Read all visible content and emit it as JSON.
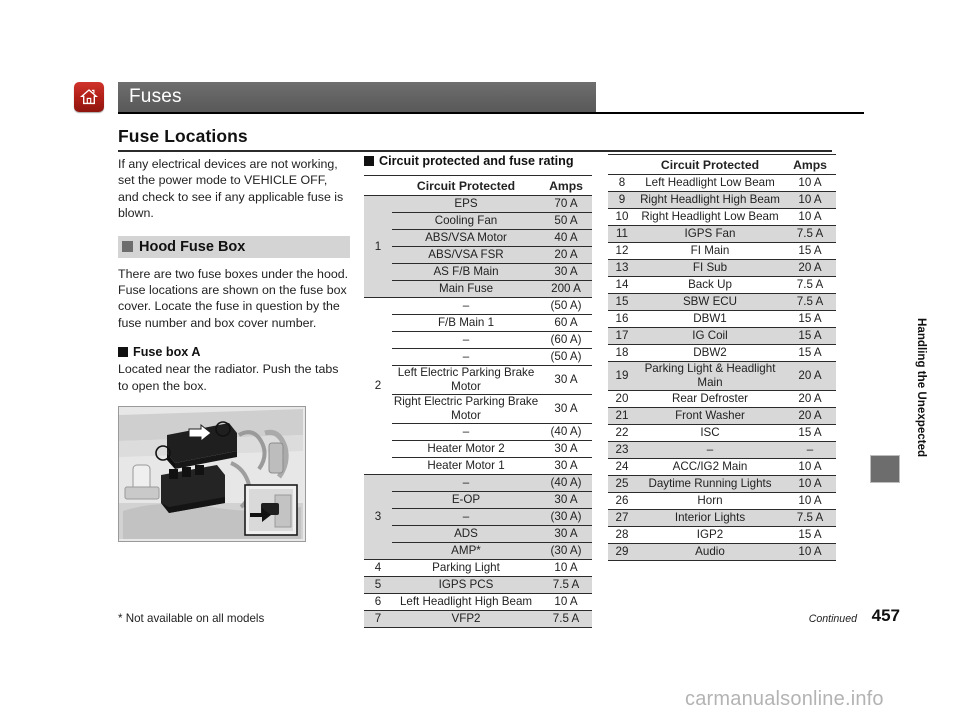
{
  "header": {
    "home_icon": "home-icon",
    "title": "Fuses"
  },
  "section": {
    "title": "Fuse Locations"
  },
  "left_column": {
    "intro_paragraph": "If any electrical devices are not working, set the power mode to VEHICLE OFF, and check to see if any applicable fuse is blown.",
    "hood_fuse_box_heading": "Hood Fuse Box",
    "hood_fuse_box_paragraph": "There are two fuse boxes under the hood. Fuse locations are shown on the fuse box cover. Locate the fuse in question by the fuse number and box cover number.",
    "fuse_box_a_heading": "Fuse box A",
    "fuse_box_a_paragraph": "Located near the radiator. Push the tabs to open the box.",
    "figure_alt": "engine-bay-fuse-box-illustration"
  },
  "table_caption": "Circuit protected and fuse rating",
  "columns": {
    "number": "",
    "circuit": "Circuit Protected",
    "amps": "Amps"
  },
  "middle_table": {
    "rows": [
      {
        "num": "1",
        "group_span": 6,
        "shaded": true,
        "circuit": "EPS",
        "amps": "70 A"
      },
      {
        "num": "",
        "shaded": true,
        "circuit": "Cooling Fan",
        "amps": "50 A"
      },
      {
        "num": "",
        "shaded": true,
        "circuit": "ABS/VSA Motor",
        "amps": "40 A"
      },
      {
        "num": "",
        "shaded": true,
        "circuit": "ABS/VSA FSR",
        "amps": "20 A"
      },
      {
        "num": "",
        "shaded": true,
        "circuit": "AS F/B Main",
        "amps": "30 A"
      },
      {
        "num": "",
        "shaded": true,
        "circuit": "Main Fuse",
        "amps": "200 A"
      },
      {
        "num": "2",
        "group_span": 9,
        "shaded": false,
        "circuit": "–",
        "amps": "(50 A)"
      },
      {
        "num": "",
        "shaded": false,
        "circuit": "F/B Main 1",
        "amps": "60 A"
      },
      {
        "num": "",
        "shaded": false,
        "circuit": "–",
        "amps": "(60 A)"
      },
      {
        "num": "",
        "shaded": false,
        "circuit": "–",
        "amps": "(50 A)"
      },
      {
        "num": "",
        "shaded": false,
        "circuit": "Left Electric Parking Brake Motor",
        "amps": "30 A",
        "two_line": true
      },
      {
        "num": "",
        "shaded": false,
        "circuit": "Right Electric Parking Brake Motor",
        "amps": "30 A",
        "two_line": true
      },
      {
        "num": "",
        "shaded": false,
        "circuit": "–",
        "amps": "(40 A)"
      },
      {
        "num": "",
        "shaded": false,
        "circuit": "Heater Motor 2",
        "amps": "30 A"
      },
      {
        "num": "",
        "shaded": false,
        "circuit": "Heater Motor 1",
        "amps": "30 A"
      },
      {
        "num": "3",
        "group_span": 5,
        "shaded": true,
        "circuit": "–",
        "amps": "(40 A)"
      },
      {
        "num": "",
        "shaded": true,
        "circuit": "E-OP",
        "amps": "30 A"
      },
      {
        "num": "",
        "shaded": true,
        "circuit": "–",
        "amps": "(30 A)"
      },
      {
        "num": "",
        "shaded": true,
        "circuit": "ADS",
        "amps": "30 A"
      },
      {
        "num": "",
        "shaded": true,
        "circuit": "AMP*",
        "amps": "(30 A)"
      },
      {
        "num": "4",
        "shaded": false,
        "circuit": "Parking Light",
        "amps": "10 A"
      },
      {
        "num": "5",
        "shaded": true,
        "circuit": "IGPS PCS",
        "amps": "7.5 A"
      },
      {
        "num": "6",
        "shaded": false,
        "circuit": "Left Headlight High Beam",
        "amps": "10 A"
      },
      {
        "num": "7",
        "shaded": true,
        "circuit": "VFP2",
        "amps": "7.5 A"
      }
    ]
  },
  "right_table": {
    "rows": [
      {
        "num": "8",
        "shaded": false,
        "circuit": "Left Headlight Low Beam",
        "amps": "10 A"
      },
      {
        "num": "9",
        "shaded": true,
        "circuit": "Right Headlight High Beam",
        "amps": "10 A"
      },
      {
        "num": "10",
        "shaded": false,
        "circuit": "Right Headlight Low Beam",
        "amps": "10 A"
      },
      {
        "num": "11",
        "shaded": true,
        "circuit": "IGPS Fan",
        "amps": "7.5 A"
      },
      {
        "num": "12",
        "shaded": false,
        "circuit": "FI Main",
        "amps": "15 A"
      },
      {
        "num": "13",
        "shaded": true,
        "circuit": "FI Sub",
        "amps": "20 A"
      },
      {
        "num": "14",
        "shaded": false,
        "circuit": "Back Up",
        "amps": "7.5 A"
      },
      {
        "num": "15",
        "shaded": true,
        "circuit": "SBW ECU",
        "amps": "7.5 A"
      },
      {
        "num": "16",
        "shaded": false,
        "circuit": "DBW1",
        "amps": "15 A"
      },
      {
        "num": "17",
        "shaded": true,
        "circuit": "IG Coil",
        "amps": "15 A"
      },
      {
        "num": "18",
        "shaded": false,
        "circuit": "DBW2",
        "amps": "15 A"
      },
      {
        "num": "19",
        "shaded": true,
        "circuit": "Parking Light & Headlight Main",
        "amps": "20 A",
        "two_line": true
      },
      {
        "num": "20",
        "shaded": false,
        "circuit": "Rear Defroster",
        "amps": "20 A"
      },
      {
        "num": "21",
        "shaded": true,
        "circuit": "Front Washer",
        "amps": "20 A"
      },
      {
        "num": "22",
        "shaded": false,
        "circuit": "ISC",
        "amps": "15 A"
      },
      {
        "num": "23",
        "shaded": true,
        "circuit": "–",
        "amps": "–"
      },
      {
        "num": "24",
        "shaded": false,
        "circuit": "ACC/IG2 Main",
        "amps": "10 A"
      },
      {
        "num": "25",
        "shaded": true,
        "circuit": "Daytime Running Lights",
        "amps": "10 A"
      },
      {
        "num": "26",
        "shaded": false,
        "circuit": "Horn",
        "amps": "10 A"
      },
      {
        "num": "27",
        "shaded": true,
        "circuit": "Interior Lights",
        "amps": "7.5 A"
      },
      {
        "num": "28",
        "shaded": false,
        "circuit": "IGP2",
        "amps": "15 A"
      },
      {
        "num": "29",
        "shaded": true,
        "circuit": "Audio",
        "amps": "10 A"
      }
    ]
  },
  "footer": {
    "footnote": "* Not available on all models",
    "continued": "Continued",
    "page_number": "457"
  },
  "sidebar": {
    "chapter_label": "Handling the Unexpected"
  },
  "watermark": "carmanualsonline.info",
  "colors": {
    "accent_red": "#b01f17",
    "header_gray": "#636363",
    "band_gray": "#d4d4d4",
    "row_shade": "#d8d8d8"
  }
}
